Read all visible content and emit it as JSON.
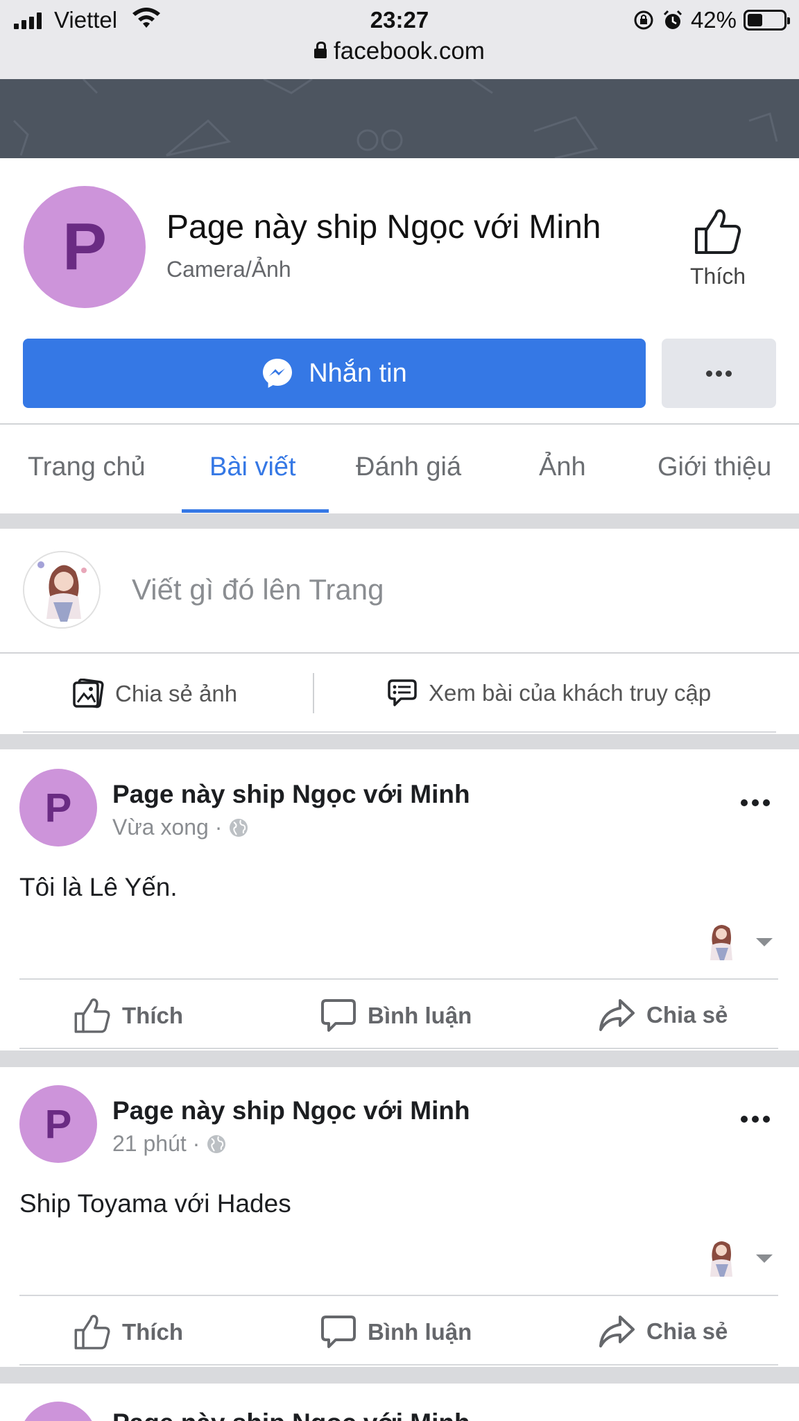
{
  "status_bar": {
    "carrier": "Viettel",
    "time": "23:27",
    "battery_percent": "42%",
    "battery_level": 0.42,
    "url": "facebook.com"
  },
  "page": {
    "avatar_letter": "P",
    "name": "Page này ship Ngọc với Minh",
    "category": "Camera/Ảnh",
    "like_label": "Thích"
  },
  "actions": {
    "message_label": "Nhắn tin"
  },
  "tabs": [
    {
      "label": "Trang chủ",
      "active": false
    },
    {
      "label": "Bài viết",
      "active": true
    },
    {
      "label": "Đánh giá",
      "active": false
    },
    {
      "label": "Ảnh",
      "active": false
    },
    {
      "label": "Giới thiệu",
      "active": false
    }
  ],
  "composer": {
    "placeholder": "Viết gì đó lên Trang",
    "share_photo": "Chia sẻ ảnh",
    "visitor_posts": "Xem bài của khách truy cập"
  },
  "posts": [
    {
      "avatar_letter": "P",
      "author": "Page này ship Ngọc với Minh",
      "time": "Vừa xong ·",
      "text": "Tôi là Lê Yến.",
      "like": "Thích",
      "comment": "Bình luận",
      "share": "Chia sẻ"
    },
    {
      "avatar_letter": "P",
      "author": "Page này ship Ngọc với Minh",
      "time": "21 phút ·",
      "text": "Ship Toyama với Hades",
      "like": "Thích",
      "comment": "Bình luận",
      "share": "Chia sẻ"
    },
    {
      "avatar_letter": "P",
      "author": "Page này ship Ngọc với Minh"
    }
  ],
  "colors": {
    "brand_blue": "#3578e5",
    "avatar_purple": "#cd94da",
    "cover": "#4d5560"
  }
}
